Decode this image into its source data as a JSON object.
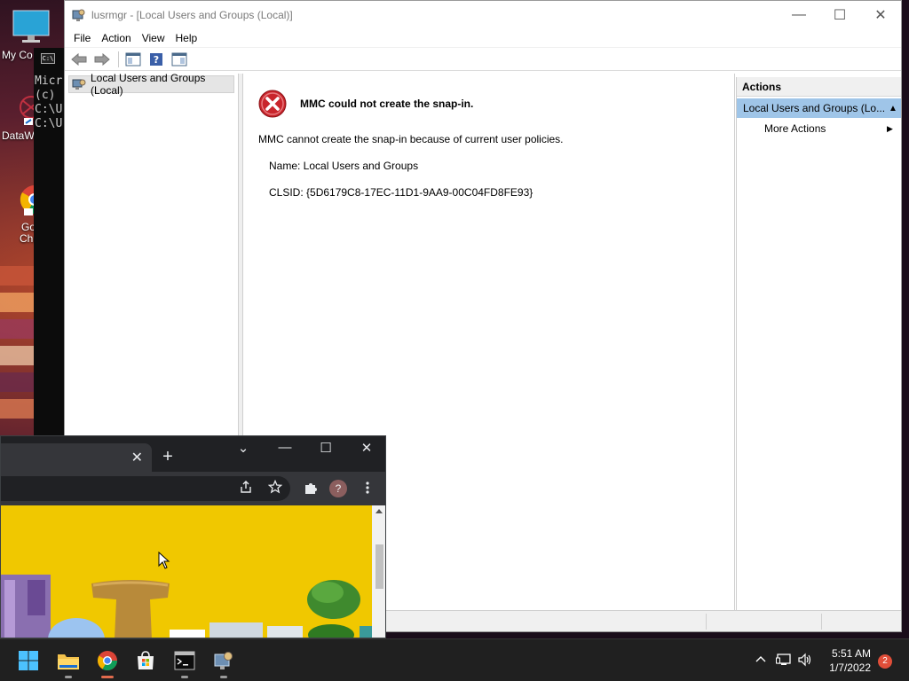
{
  "desktop": {
    "icons": [
      {
        "label": "My Co",
        "icon": "computer-icon"
      },
      {
        "label": "DataW",
        "icon": "datawarehouse-shortcut-icon"
      },
      {
        "label": "Goc\nChro",
        "icon": "chrome-shortcut-icon"
      }
    ]
  },
  "console": {
    "lines": [
      "Micr",
      "(c)",
      "",
      "C:\\U",
      "",
      "C:\\U"
    ]
  },
  "mmc": {
    "title": "lusrmgr - [Local Users and Groups (Local)]",
    "menu": [
      "File",
      "Action",
      "View",
      "Help"
    ],
    "toolbar_icons": [
      "back-arrow-icon",
      "forward-arrow-icon",
      "show-hide-console-tree-icon",
      "help-icon",
      "show-hide-action-pane-icon"
    ],
    "tree_root": "Local Users and Groups (Local)",
    "error": {
      "title": "MMC could not create the snap-in.",
      "message": "MMC cannot create the snap-in because of current user policies.",
      "name_line": "Name: Local Users and Groups",
      "clsid_line": "CLSID: {5D6179C8-17EC-11D1-9AA9-00C04FD8FE93}"
    },
    "actions": {
      "header": "Actions",
      "group": "Local Users and Groups (Lo...",
      "more": "More Actions"
    },
    "window_controls": {
      "minimize": "—",
      "maximize": "☐",
      "close": "✕"
    }
  },
  "chrome": {
    "tab_close": "✕",
    "new_tab": "+",
    "controls": {
      "dropdown": "⌄",
      "minimize": "—",
      "maximize": "☐",
      "close": "✕"
    },
    "profile_initial": "?",
    "page_colors": {
      "background": "#f0c800"
    }
  },
  "taskbar": {
    "apps": [
      "start-icon",
      "file-explorer-icon",
      "chrome-icon",
      "microsoft-store-icon",
      "command-prompt-icon",
      "mmc-icon"
    ],
    "time": "5:51 AM",
    "date": "1/7/2022",
    "notifications": "2"
  }
}
